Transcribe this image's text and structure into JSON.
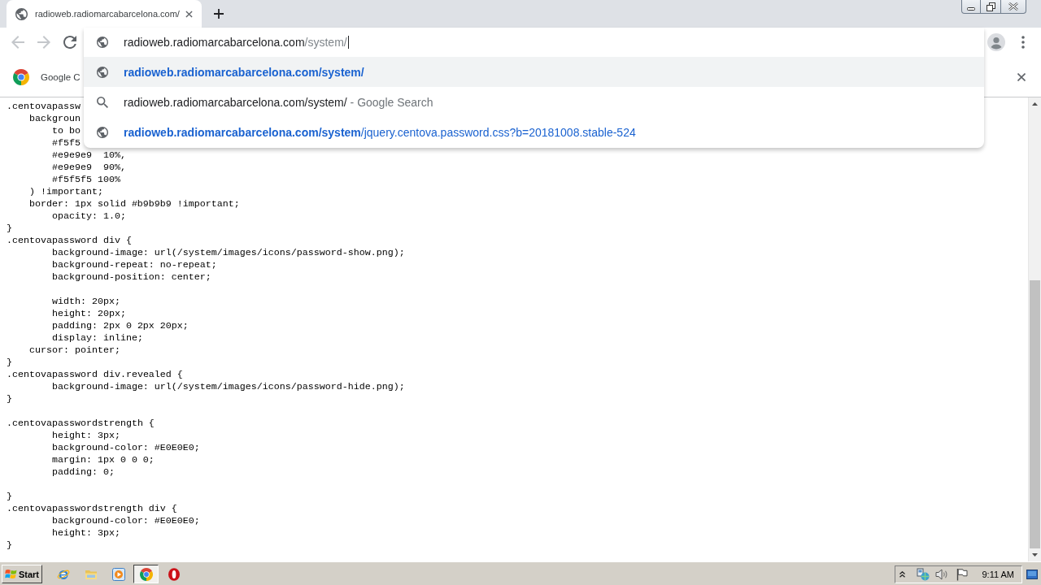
{
  "tab": {
    "title": "radioweb.radiomarcabarcelona.com/"
  },
  "nav_buttons": [
    {
      "kind": "back",
      "disabled": true
    },
    {
      "kind": "forward",
      "disabled": true
    },
    {
      "kind": "reload",
      "disabled": false
    }
  ],
  "omnibox": {
    "host": "radioweb.radiomarcabarcelona.com",
    "path": "/system/"
  },
  "suggestions": [
    {
      "kind": "url",
      "match": "radioweb.radiomarcabarcelona.com/system/",
      "selected": true
    },
    {
      "kind": "search",
      "text": "radioweb.radiomarcabarcelona.com/system/",
      "description": "- Google Search",
      "selected": false
    },
    {
      "kind": "url",
      "match": "radioweb.radiomarcabarcelona.com/system",
      "rest": "/jquery.centova.password.css?b=20181008.stable-524",
      "selected": false
    }
  ],
  "infobar": {
    "text": "Google C"
  },
  "code": {
    "blocks": [
      [
        ".centovapassw",
        "    backgroun",
        "        to bo",
        "        #f5f5",
        "        #e9e9e9  10%,",
        "        #e9e9e9  90%,",
        "        #f5f5f5 100%",
        "    ) !important;",
        "    border: 1px solid #b9b9b9 !important;",
        "        opacity: 1.0;",
        "}",
        ".centovapassword div {",
        "        background-image: url(/system/images/icons/password-show.png);",
        "        background-repeat: no-repeat;",
        "        background-position: center;"
      ],
      [
        "        width: 20px;",
        "        height: 20px;",
        "        padding: 2px 0 2px 20px;",
        "        display: inline;",
        "    cursor: pointer;",
        "}",
        ".centovapassword div.revealed {",
        "        background-image: url(/system/images/icons/password-hide.png);",
        "}"
      ],
      [
        ".centovapasswordstrength {",
        "        height: 3px;",
        "        background-color: #E0E0E0;",
        "        margin: 1px 0 0 0;",
        "        padding: 0;"
      ],
      [
        "}",
        ".centovapasswordstrength div {",
        "        background-color: #E0E0E0;",
        "        height: 3px;",
        "}"
      ]
    ]
  },
  "taskbar": {
    "start": "Start",
    "apps": [
      {
        "kind": "e",
        "selected": false
      },
      {
        "kind": "folder",
        "selected": false
      },
      {
        "kind": "player",
        "selected": false
      },
      {
        "kind": "chrome",
        "selected": true
      },
      {
        "kind": "ring",
        "selected": false
      }
    ],
    "clock": "9:11 AM"
  }
}
